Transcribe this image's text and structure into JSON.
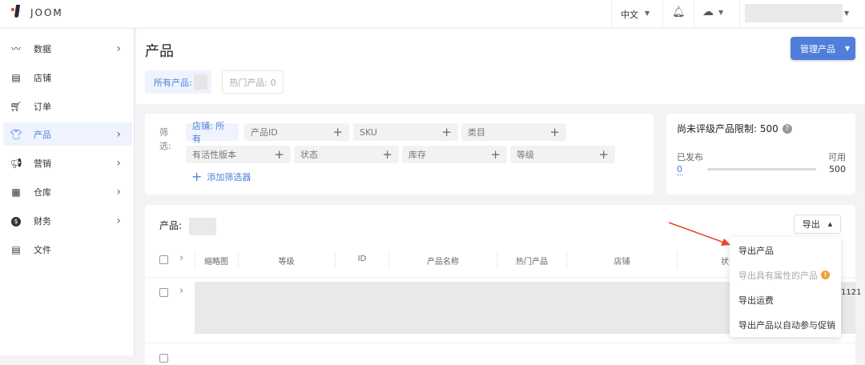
{
  "topbar": {
    "brand": "JOOM",
    "language": "中文"
  },
  "sidebar": {
    "items": [
      {
        "label": "数据",
        "icon": "chart-line-icon",
        "chevron": true
      },
      {
        "label": "店铺",
        "icon": "store-icon",
        "chevron": false
      },
      {
        "label": "订单",
        "icon": "cart-icon",
        "chevron": false
      },
      {
        "label": "产品",
        "icon": "tshirt-icon",
        "chevron": true,
        "active": true
      },
      {
        "label": "营销",
        "icon": "megaphone-icon",
        "chevron": true
      },
      {
        "label": "仓库",
        "icon": "boxes-icon",
        "chevron": true
      },
      {
        "label": "财务",
        "icon": "dollar-icon",
        "chevron": true
      },
      {
        "label": "文件",
        "icon": "document-icon",
        "chevron": false
      }
    ]
  },
  "header": {
    "title": "产品",
    "tabs": [
      {
        "label": "所有产品:"
      },
      {
        "label": "热门产品: 0"
      }
    ],
    "manage_button": "管理产品"
  },
  "filters": {
    "label": "筛选:",
    "chips": [
      "店铺: 所有",
      "产品ID",
      "SKU",
      "类目",
      "有活性版本",
      "状态",
      "库存",
      "等级"
    ],
    "add_label": "添加筛选器"
  },
  "limit": {
    "title": "尚未评级产品限制: 500",
    "published_label": "已发布",
    "available_label": "可用",
    "published": "0",
    "available": "500",
    "progress_percent": 0
  },
  "products": {
    "title": "产品:",
    "export_button": "导出",
    "columns": [
      "缩略图",
      "等级",
      "ID",
      "产品名称",
      "热门产品",
      "店铺",
      "状"
    ],
    "row_partial_text": "1121",
    "export_menu": [
      {
        "label": "导出产品",
        "disabled": false
      },
      {
        "label": "导出具有属性的产品",
        "disabled": true,
        "warning": true
      },
      {
        "label": "导出运费",
        "disabled": false
      },
      {
        "label": "导出产品以自动参与促销",
        "disabled": false
      }
    ]
  },
  "colors": {
    "accent": "#4f7fdb",
    "arrow": "#e8452c",
    "warning": "#f0a030"
  }
}
